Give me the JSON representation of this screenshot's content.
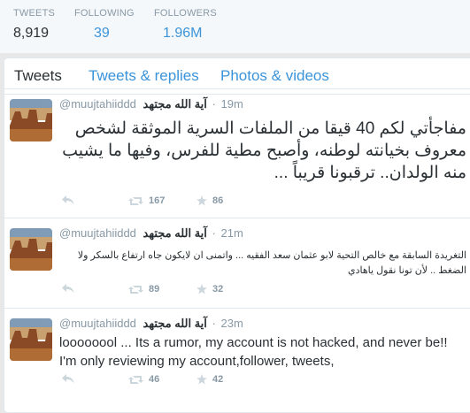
{
  "stats": {
    "tweets": {
      "label": "TWEETS",
      "value": "8,919"
    },
    "following": {
      "label": "FOLLOWING",
      "value": "39"
    },
    "followers": {
      "label": "FOLLOWERS",
      "value": "1.96M"
    }
  },
  "tabs": [
    "Tweets",
    "Tweets & replies",
    "Photos & videos"
  ],
  "tweets": [
    {
      "handle": "@muujtahiiddd",
      "name": "آية الله مجتهد",
      "time": "19m",
      "text": "مفاجأتي لكم 40 قيقا من الملفات السرية الموثقة لشخص معروف بخيانته لوطنه، وأصبح مطية للفرس، وفيها ما يشيب منه الولدان.. ترقبونا قريباً ...",
      "retweets": "167",
      "favorites": "86"
    },
    {
      "handle": "@muujtahiiddd",
      "name": "آية الله مجتهد",
      "time": "21m",
      "text": "التغريدة السابقة مع خالص التحية لابو عثمان سعد الفقيه ... واتمنى ان لايكون جاه ارتفاع بالسكر ولا الضغط .. لأن تونا نقول ياهادي",
      "retweets": "89",
      "favorites": "32"
    },
    {
      "handle": "@muujtahiiddd",
      "name": "آية الله مجتهد",
      "time": "23m",
      "text": "loooooool ... Its a rumor, my account is not hacked, and never be!! I'm only reviewing my account,follower, tweets,",
      "retweets": "46",
      "favorites": "42"
    }
  ]
}
